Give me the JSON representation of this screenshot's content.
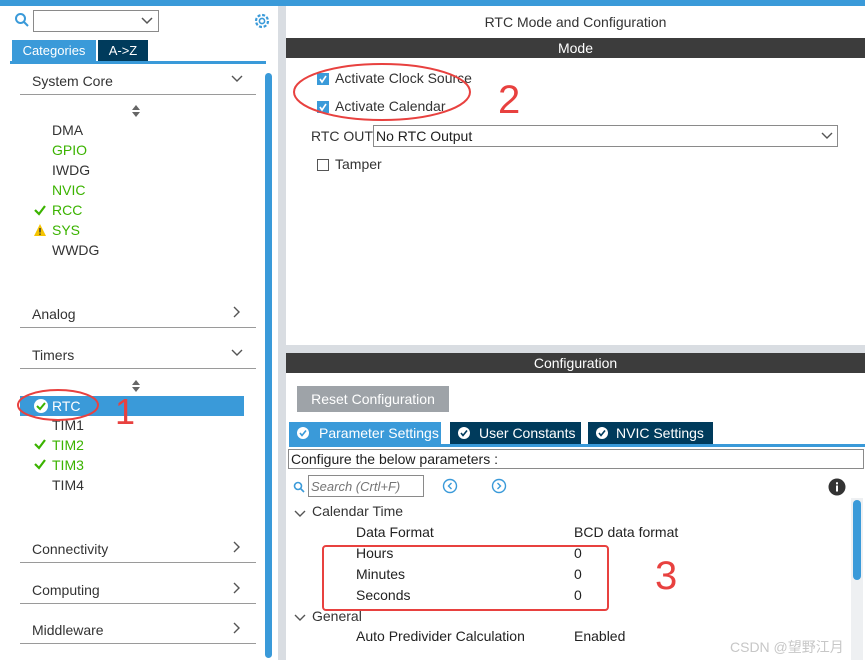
{
  "left_panel": {
    "search": {
      "value": "",
      "placeholder": ""
    },
    "tabs": [
      {
        "label": "Categories"
      },
      {
        "label": "A->Z"
      }
    ],
    "sections": {
      "system_core": {
        "label": "System Core",
        "items": [
          "DMA",
          "GPIO",
          "IWDG",
          "NVIC",
          "RCC",
          "SYS",
          "WWDG"
        ]
      },
      "analog": {
        "label": "Analog"
      },
      "timers": {
        "label": "Timers",
        "items": [
          "RTC",
          "TIM1",
          "TIM2",
          "TIM3",
          "TIM4"
        ]
      },
      "connectivity": {
        "label": "Connectivity"
      },
      "computing": {
        "label": "Computing"
      },
      "middleware": {
        "label": "Middleware"
      }
    }
  },
  "right_panel": {
    "title": "RTC Mode and Configuration",
    "mode_header": "Mode",
    "activate_clock_source": {
      "label": "Activate Clock Source",
      "checked": true
    },
    "activate_calendar": {
      "label": "Activate Calendar",
      "checked": true
    },
    "rtc_out": {
      "label": "RTC OUT",
      "value": "No RTC Output"
    },
    "tamper": {
      "label": "Tamper",
      "checked": false
    },
    "config_header": "Configuration",
    "reset_button": "Reset Configuration",
    "tabs": [
      {
        "label": "Parameter Settings"
      },
      {
        "label": "User Constants"
      },
      {
        "label": "NVIC Settings"
      }
    ],
    "configure_text": "Configure the below parameters :",
    "search_placeholder": "Search (Crtl+F)",
    "groups": {
      "calendar_time": {
        "label": "Calendar Time",
        "params": [
          {
            "name": "Data Format",
            "value": "BCD data format"
          },
          {
            "name": "Hours",
            "value": "0"
          },
          {
            "name": "Minutes",
            "value": "0"
          },
          {
            "name": "Seconds",
            "value": "0"
          }
        ]
      },
      "general": {
        "label": "General",
        "params": [
          {
            "name": "Auto Predivider Calculation",
            "value": "Enabled"
          }
        ]
      }
    }
  },
  "annotations": {
    "mark1": "1",
    "mark2": "2",
    "mark3": "3"
  },
  "watermark": "CSDN @望野江月",
  "colors": {
    "accent": "#3a9ad9",
    "dark_header": "#3c3c3c",
    "green": "#3bb300",
    "warning": "#f5c400",
    "annotation": "#e8413f"
  }
}
